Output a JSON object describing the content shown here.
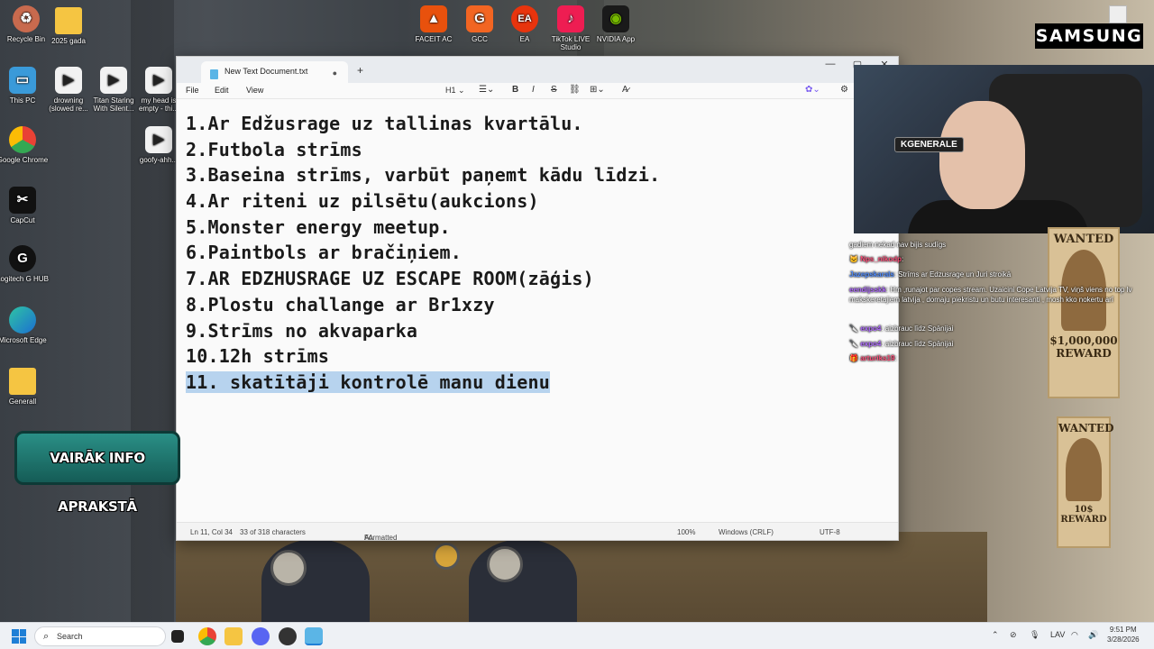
{
  "desktop": {
    "icons_left": [
      {
        "label": "Recycle Bin",
        "icon": "recycle-bin-icon"
      },
      {
        "label": "2025 gada",
        "icon": "folder-icon"
      },
      {
        "label": "This PC",
        "icon": "monitor-icon"
      },
      {
        "label": "drowning (slowed re...",
        "icon": "video-file-icon"
      },
      {
        "label": "Titan Staring With Silent...",
        "icon": "video-file-icon"
      },
      {
        "label": "my head is empty - thi...",
        "icon": "video-file-icon"
      },
      {
        "label": "Google Chrome",
        "icon": "chrome-icon"
      },
      {
        "label": "goofy-ahh...",
        "icon": "video-file-icon"
      },
      {
        "label": "CapCut",
        "icon": "capcut-icon"
      },
      {
        "label": "Logitech G HUB",
        "icon": "logitech-icon"
      },
      {
        "label": "Microsoft Edge",
        "icon": "edge-icon"
      },
      {
        "label": "Generall",
        "icon": "folder-icon"
      }
    ],
    "icons_top": [
      {
        "label": "FACEIT AC",
        "icon": "faceit-icon",
        "color": "#e8510d"
      },
      {
        "label": "GCC",
        "icon": "gcc-icon",
        "color": "#f26522"
      },
      {
        "label": "EA",
        "icon": "ea-icon",
        "color": "#e8340d"
      },
      {
        "label": "TikTok LIVE Studio",
        "icon": "tiktok-icon",
        "color": "#ee1d52"
      },
      {
        "label": "NVIDIA App",
        "icon": "nvidia-icon",
        "color": "#1a1a1a"
      }
    ]
  },
  "notepad": {
    "tab_title": "New Text Document.txt",
    "menus": [
      "File",
      "Edit",
      "View"
    ],
    "heading_selector": "H1",
    "lines": [
      "1.Ar Edžusrage uz tallinas kvartālu.",
      "2.Futbola strīms",
      "3.Baseina strīms, varbūt paņemt kādu līdzi.",
      "4.Ar riteni uz pilsētu(aukcions)",
      "5.Monster energy meetup.",
      "6.Paintbols ar bračiņiem.",
      "7.AR EDZHUSRAGE UZ ESCAPE ROOM(zāģis)",
      "8.Plostu challange ar Br1xzy",
      "9.Strīms no akvaparka",
      "10.12h strīms",
      "11. skatītāji kontrolē manu dienu"
    ],
    "selected_line_index": 10,
    "status": {
      "position": "Ln 11, Col 34",
      "chars": "33 of 318 characters",
      "format": "Formatted",
      "zoom": "100%",
      "line_ending": "Windows (CRLF)",
      "encoding": "UTF-8"
    }
  },
  "overlay": {
    "samsung": "SAMSUNG",
    "webcam_tag": "KGENERALE",
    "banner": "VAIRĀK INFO APRAKSTĀ"
  },
  "chat": [
    {
      "user": "",
      "text": "gadiem nekad nav bijis sudīgs",
      "color": "#ffffff"
    },
    {
      "user": "Nps_nikodp",
      "text": "",
      "color": "#ff4f7a"
    },
    {
      "user": "Jazepskarals",
      "text": "Strīms ar Edzusrage un Juri stroikā",
      "color": "#4f8cff"
    },
    {
      "user": "eendijsskk",
      "text": "Hm ,runajot par copes stream. Uzaicini Cope Latvija TV, viņš viens no top lv makskeretajiem latvija , domaju piekristu un butu interesanti , mosh kko nokertu arī",
      "color": "#b06bff"
    },
    {
      "user": "expo4",
      "text": "aizbrauc līdz Spānijai",
      "color": "#b06bff"
    },
    {
      "user": "expo4",
      "text": "aizbrauc līdz Spānijai",
      "color": "#b06bff"
    },
    {
      "user": "arturiks19",
      "text": "",
      "color": "#ff4f7a"
    }
  ],
  "posters": [
    {
      "top": "WANTED",
      "reward": "$1,000,000",
      "sub": "REWARD"
    },
    {
      "top": "WANTED",
      "reward": "10$",
      "sub": "REWARD"
    }
  ],
  "taskbar": {
    "search_placeholder": "Search",
    "language": "LAV",
    "time": "9:51 PM",
    "date": "3/28/2026"
  }
}
